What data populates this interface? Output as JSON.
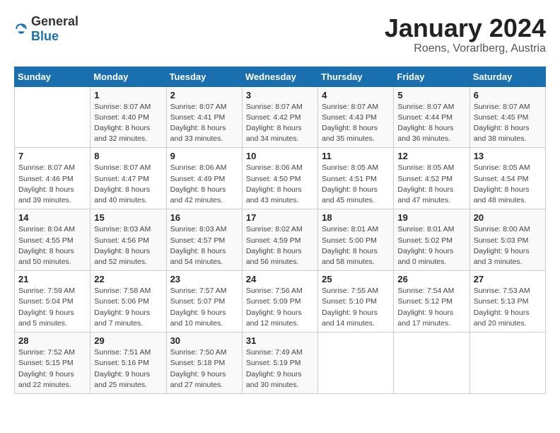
{
  "header": {
    "logo_general": "General",
    "logo_blue": "Blue",
    "month_year": "January 2024",
    "location": "Roens, Vorarlberg, Austria"
  },
  "weekdays": [
    "Sunday",
    "Monday",
    "Tuesday",
    "Wednesday",
    "Thursday",
    "Friday",
    "Saturday"
  ],
  "weeks": [
    [
      {
        "day": "",
        "info": ""
      },
      {
        "day": "1",
        "info": "Sunrise: 8:07 AM\nSunset: 4:40 PM\nDaylight: 8 hours\nand 32 minutes."
      },
      {
        "day": "2",
        "info": "Sunrise: 8:07 AM\nSunset: 4:41 PM\nDaylight: 8 hours\nand 33 minutes."
      },
      {
        "day": "3",
        "info": "Sunrise: 8:07 AM\nSunset: 4:42 PM\nDaylight: 8 hours\nand 34 minutes."
      },
      {
        "day": "4",
        "info": "Sunrise: 8:07 AM\nSunset: 4:43 PM\nDaylight: 8 hours\nand 35 minutes."
      },
      {
        "day": "5",
        "info": "Sunrise: 8:07 AM\nSunset: 4:44 PM\nDaylight: 8 hours\nand 36 minutes."
      },
      {
        "day": "6",
        "info": "Sunrise: 8:07 AM\nSunset: 4:45 PM\nDaylight: 8 hours\nand 38 minutes."
      }
    ],
    [
      {
        "day": "7",
        "info": "Sunrise: 8:07 AM\nSunset: 4:46 PM\nDaylight: 8 hours\nand 39 minutes."
      },
      {
        "day": "8",
        "info": "Sunrise: 8:07 AM\nSunset: 4:47 PM\nDaylight: 8 hours\nand 40 minutes."
      },
      {
        "day": "9",
        "info": "Sunrise: 8:06 AM\nSunset: 4:49 PM\nDaylight: 8 hours\nand 42 minutes."
      },
      {
        "day": "10",
        "info": "Sunrise: 8:06 AM\nSunset: 4:50 PM\nDaylight: 8 hours\nand 43 minutes."
      },
      {
        "day": "11",
        "info": "Sunrise: 8:05 AM\nSunset: 4:51 PM\nDaylight: 8 hours\nand 45 minutes."
      },
      {
        "day": "12",
        "info": "Sunrise: 8:05 AM\nSunset: 4:52 PM\nDaylight: 8 hours\nand 47 minutes."
      },
      {
        "day": "13",
        "info": "Sunrise: 8:05 AM\nSunset: 4:54 PM\nDaylight: 8 hours\nand 48 minutes."
      }
    ],
    [
      {
        "day": "14",
        "info": "Sunrise: 8:04 AM\nSunset: 4:55 PM\nDaylight: 8 hours\nand 50 minutes."
      },
      {
        "day": "15",
        "info": "Sunrise: 8:03 AM\nSunset: 4:56 PM\nDaylight: 8 hours\nand 52 minutes."
      },
      {
        "day": "16",
        "info": "Sunrise: 8:03 AM\nSunset: 4:57 PM\nDaylight: 8 hours\nand 54 minutes."
      },
      {
        "day": "17",
        "info": "Sunrise: 8:02 AM\nSunset: 4:59 PM\nDaylight: 8 hours\nand 56 minutes."
      },
      {
        "day": "18",
        "info": "Sunrise: 8:01 AM\nSunset: 5:00 PM\nDaylight: 8 hours\nand 58 minutes."
      },
      {
        "day": "19",
        "info": "Sunrise: 8:01 AM\nSunset: 5:02 PM\nDaylight: 9 hours\nand 0 minutes."
      },
      {
        "day": "20",
        "info": "Sunrise: 8:00 AM\nSunset: 5:03 PM\nDaylight: 9 hours\nand 3 minutes."
      }
    ],
    [
      {
        "day": "21",
        "info": "Sunrise: 7:59 AM\nSunset: 5:04 PM\nDaylight: 9 hours\nand 5 minutes."
      },
      {
        "day": "22",
        "info": "Sunrise: 7:58 AM\nSunset: 5:06 PM\nDaylight: 9 hours\nand 7 minutes."
      },
      {
        "day": "23",
        "info": "Sunrise: 7:57 AM\nSunset: 5:07 PM\nDaylight: 9 hours\nand 10 minutes."
      },
      {
        "day": "24",
        "info": "Sunrise: 7:56 AM\nSunset: 5:09 PM\nDaylight: 9 hours\nand 12 minutes."
      },
      {
        "day": "25",
        "info": "Sunrise: 7:55 AM\nSunset: 5:10 PM\nDaylight: 9 hours\nand 14 minutes."
      },
      {
        "day": "26",
        "info": "Sunrise: 7:54 AM\nSunset: 5:12 PM\nDaylight: 9 hours\nand 17 minutes."
      },
      {
        "day": "27",
        "info": "Sunrise: 7:53 AM\nSunset: 5:13 PM\nDaylight: 9 hours\nand 20 minutes."
      }
    ],
    [
      {
        "day": "28",
        "info": "Sunrise: 7:52 AM\nSunset: 5:15 PM\nDaylight: 9 hours\nand 22 minutes."
      },
      {
        "day": "29",
        "info": "Sunrise: 7:51 AM\nSunset: 5:16 PM\nDaylight: 9 hours\nand 25 minutes."
      },
      {
        "day": "30",
        "info": "Sunrise: 7:50 AM\nSunset: 5:18 PM\nDaylight: 9 hours\nand 27 minutes."
      },
      {
        "day": "31",
        "info": "Sunrise: 7:49 AM\nSunset: 5:19 PM\nDaylight: 9 hours\nand 30 minutes."
      },
      {
        "day": "",
        "info": ""
      },
      {
        "day": "",
        "info": ""
      },
      {
        "day": "",
        "info": ""
      }
    ]
  ]
}
